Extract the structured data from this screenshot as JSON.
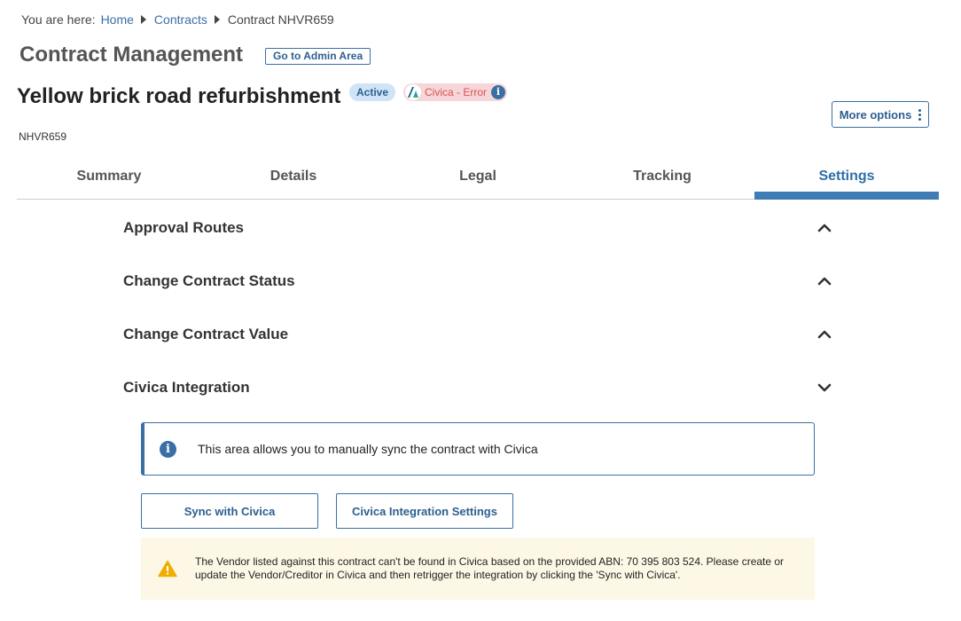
{
  "breadcrumb": {
    "prefix": "You are here:",
    "items": [
      "Home",
      "Contracts",
      "Contract NHVR659"
    ]
  },
  "header": {
    "title": "Contract Management",
    "admin_button": "Go to Admin Area",
    "contract_title": "Yellow brick road refurbishment",
    "status_badge": "Active",
    "integration_badge": "Civica - Error",
    "contract_code": "NHVR659",
    "more_options": "More options"
  },
  "tabs": [
    {
      "label": "Summary",
      "active": false
    },
    {
      "label": "Details",
      "active": false
    },
    {
      "label": "Legal",
      "active": false
    },
    {
      "label": "Tracking",
      "active": false
    },
    {
      "label": "Settings",
      "active": true
    }
  ],
  "sections": [
    {
      "label": "Approval Routes",
      "expanded": false
    },
    {
      "label": "Change Contract Status",
      "expanded": false
    },
    {
      "label": "Change Contract Value",
      "expanded": false
    },
    {
      "label": "Civica Integration",
      "expanded": true
    }
  ],
  "civica": {
    "info_text": "This area allows you to manually sync the contract with Civica",
    "sync_button": "Sync with Civica",
    "settings_button": "Civica Integration Settings",
    "warning_text": "The Vendor listed against this contract can't be found in Civica based on the provided ABN: 70 395 803 524. Please create or update the Vendor/Creditor in Civica and then retrigger the integration by clicking the 'Sync with Civica'."
  },
  "colors": {
    "accent": "#3a6fa5",
    "active_tab": "#2d6fa8",
    "error": "#d9534f",
    "warning_bg": "#fdf8e6",
    "warning_icon": "#f0ad00"
  }
}
